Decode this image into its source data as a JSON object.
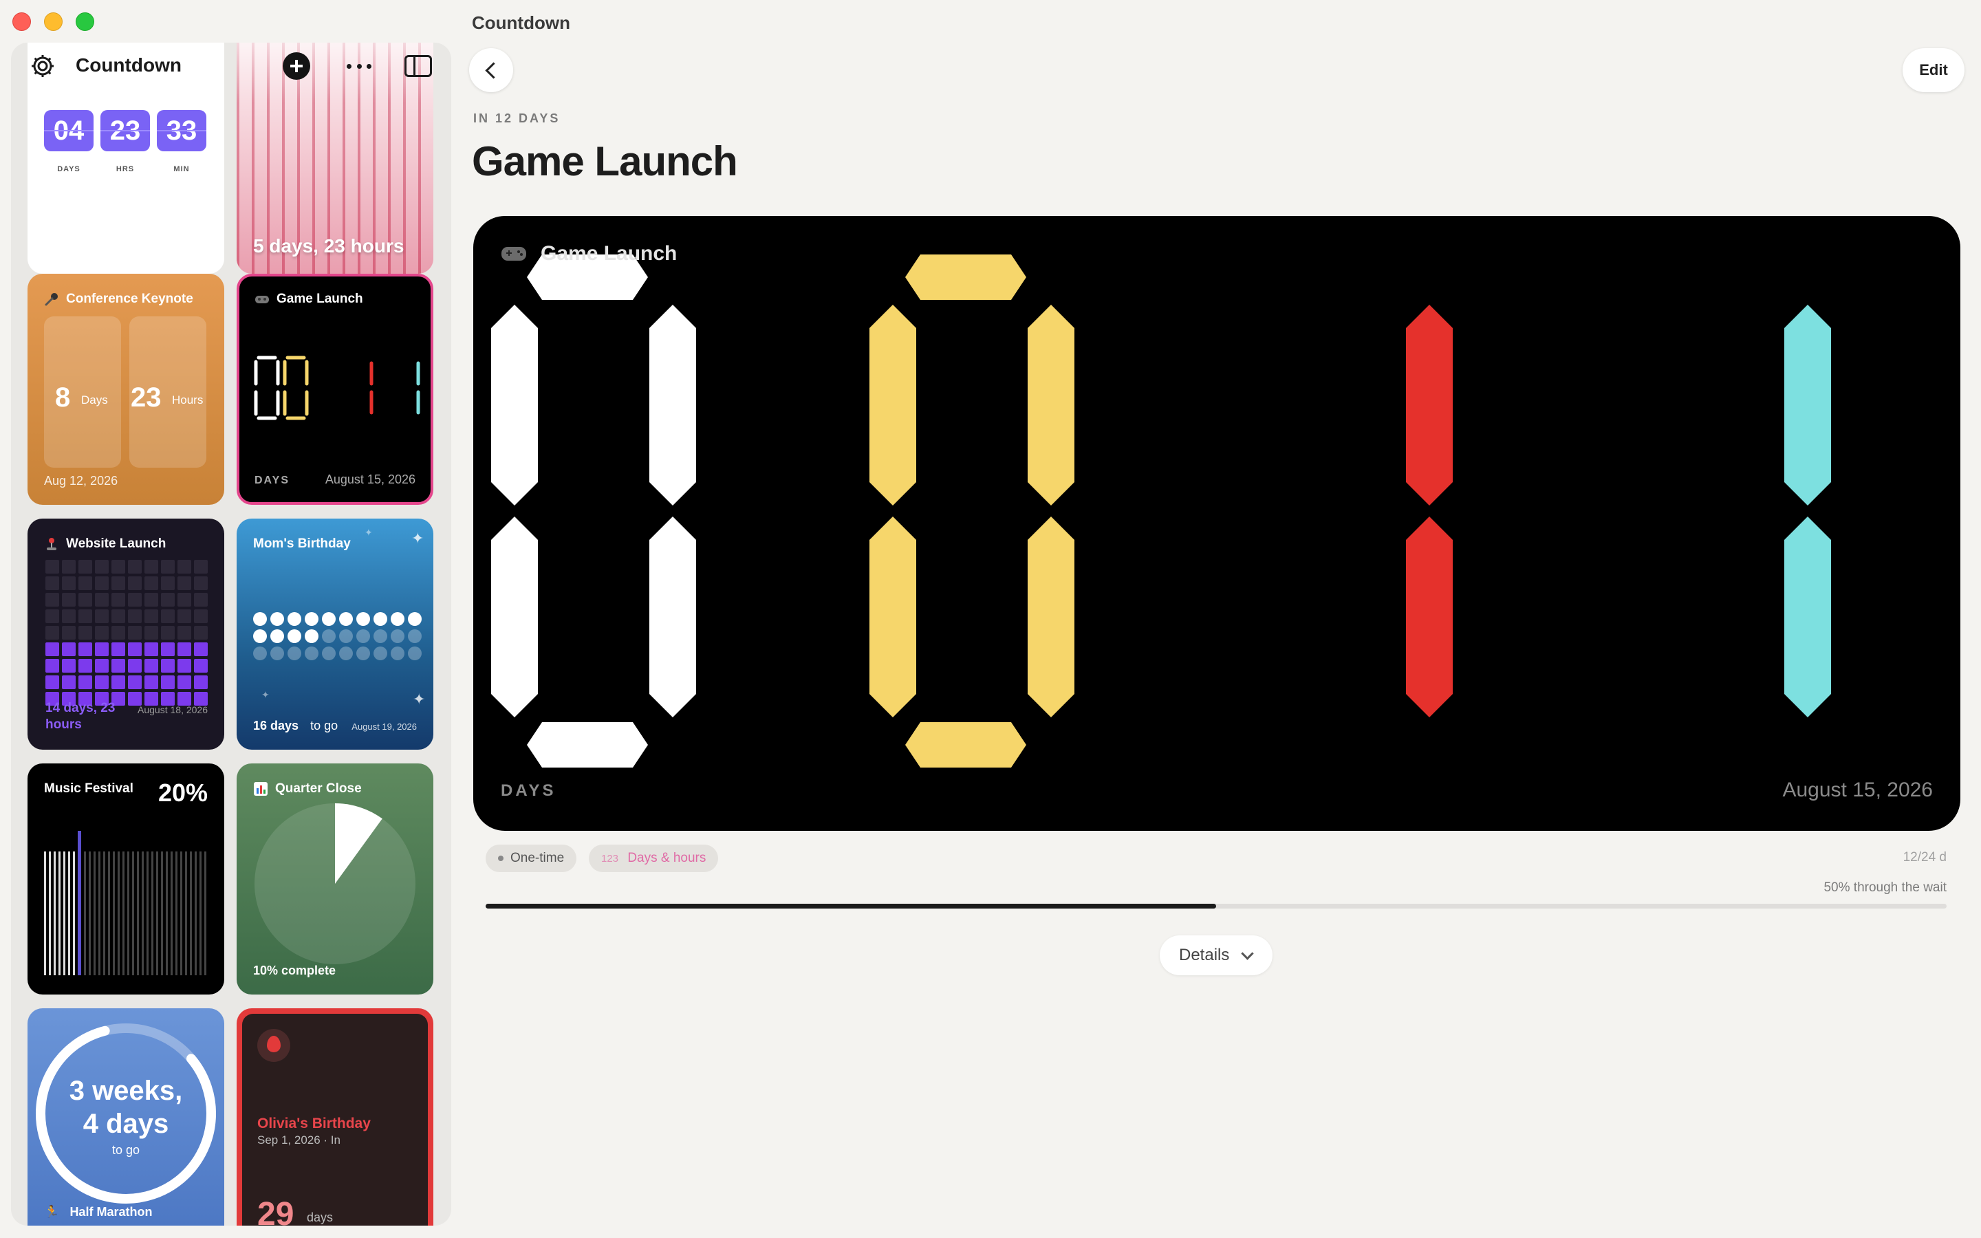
{
  "window": {
    "title": "Countdown"
  },
  "sidebar": {
    "title": "Countdown",
    "cards": {
      "flip": {
        "values": [
          "04",
          "23",
          "33"
        ],
        "labels": [
          "DAYS",
          "HRS",
          "MIN"
        ]
      },
      "stripes": {
        "text": "5 days, 23 hours"
      },
      "conference": {
        "name": "Conference Keynote",
        "icon": "microphone-icon",
        "days_value": "8",
        "days_label": "Days",
        "hours_value": "23",
        "hours_label": "Hours",
        "date": "Aug 12, 2026"
      },
      "game": {
        "name": "Game Launch",
        "icon": "gamepad-icon",
        "digits": "0011",
        "unit": "DAYS",
        "date": "August 15, 2026"
      },
      "website": {
        "name": "Website Launch",
        "icon": "joystick-icon",
        "remaining": "14 days, 23 hours",
        "date": "August 18, 2026",
        "filled_blocks": 40,
        "total_blocks": 90
      },
      "mom": {
        "name": "Mom's Birthday",
        "value": "16 days",
        "suffix": "to go",
        "date": "August 19, 2026",
        "filled_dots": 14,
        "total_dots": 30
      },
      "music": {
        "name": "Music Festival",
        "percent": "20%"
      },
      "quarter": {
        "name": "Quarter Close",
        "icon": "chart-icon",
        "progress_text": "10% complete",
        "progress": 0.1
      },
      "marathon": {
        "line1": "3 weeks,",
        "line2": "4 days",
        "sub": "to go",
        "name": "Half Marathon",
        "icon": "runner-icon"
      },
      "olivia": {
        "name": "Olivia's Birthday",
        "sub": "Sep 1, 2026 · In",
        "value": "29",
        "unit": "days"
      }
    }
  },
  "main": {
    "title": "Countdown",
    "edit_label": "Edit",
    "eyebrow": "IN 12 DAYS",
    "event_title": "Game Launch",
    "display": {
      "title": "Game Launch",
      "digits": [
        "0",
        "0",
        "1",
        "1"
      ],
      "digit_colors": [
        "#ffffff",
        "#f6d66b",
        "#e5312c",
        "#7de0e0"
      ],
      "unit": "DAYS",
      "date": "August 15, 2026"
    },
    "tags": {
      "repeat": "One-time",
      "format_prefix": "123",
      "format": "Days & hours"
    },
    "ratio": "12/24 d",
    "wait_text": "50% through the wait",
    "progress": 0.5,
    "details_label": "Details"
  }
}
